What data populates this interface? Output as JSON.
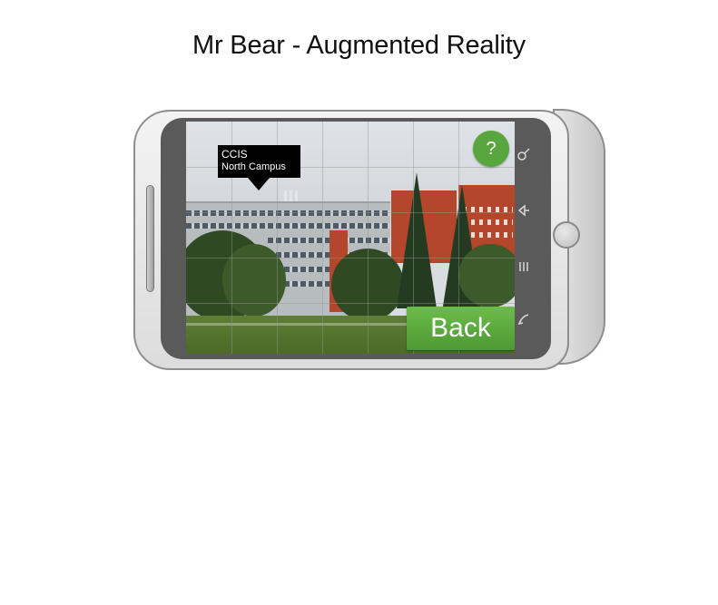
{
  "page": {
    "title": "Mr Bear - Augmented Reality"
  },
  "ar_marker": {
    "name": "CCIS",
    "location": "North Campus"
  },
  "buttons": {
    "help_label": "?",
    "back_label": "Back"
  },
  "softkeys": [
    "search-icon",
    "home-icon",
    "menu-icon",
    "back-nav-icon"
  ],
  "colors": {
    "accent_green": "#5aa63e",
    "tag_bg": "#000000"
  }
}
